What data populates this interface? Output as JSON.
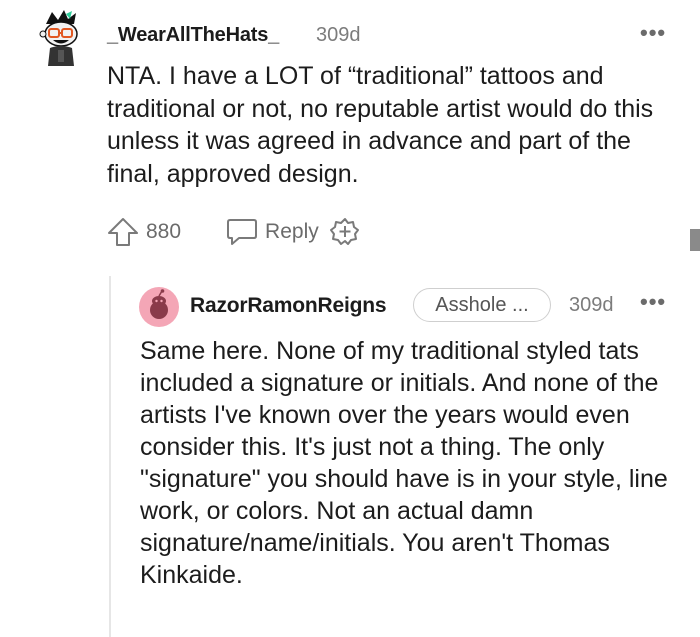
{
  "comment": {
    "username": "_WearAllTheHats_",
    "age": "309d",
    "more": "•••",
    "text": "NTA. I have a LOT of “traditional” tattoos and traditional or not, no reputable artist would do this unless it was agreed in advance and part of the final, approved design.",
    "score": "880",
    "reply_label": "Reply",
    "icons": {
      "upvote": "upvote-arrow-icon",
      "reply": "speech-bubble-icon",
      "award": "add-award-icon"
    }
  },
  "reply": {
    "username": "RazorRamonReigns",
    "flair": "Asshole ...",
    "age": "309d",
    "more": "•••",
    "text": "Same here. None of my traditional styled tats included a signature or initials. And none of the artists I've known over the years would even consider this. It's just not a thing. The only \"signature\" you should have is in your style, line work, or colors. Not an actual damn signature/name/initials. You aren't Thomas Kinkaide."
  },
  "colors": {
    "text": "#1c1c1c",
    "meta": "#7c7c7c",
    "icon": "#6b6b6b",
    "avatar_pink": "#f4a6b6",
    "avatar_green": "#2ecc9a"
  }
}
